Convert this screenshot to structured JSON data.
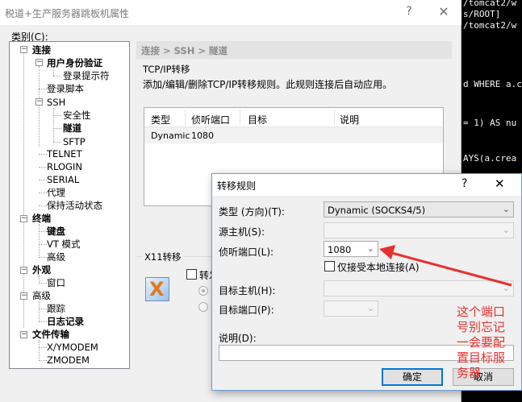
{
  "terminal": {
    "lines": [
      "/tomcat2/w",
      "s/ROOT]",
      "/tomcat2/w",
      "d WHERE a.c",
      "= 1) AS nu",
      "AYS(a.crea"
    ]
  },
  "main_dialog": {
    "title": "税道+生产服务器跳板机属性",
    "help": "?",
    "close": "✕",
    "category_label": "类别(C):",
    "tree": {
      "connect": "连接",
      "auth": "用户身份验证",
      "login_prompt": "登录提示符",
      "login_script": "登录脚本",
      "ssh": "SSH",
      "security": "安全性",
      "tunnel": "隧道",
      "sftp": "SFTP",
      "telnet": "TELNET",
      "rlogin": "RLOGIN",
      "serial": "SERIAL",
      "proxy": "代理",
      "keepalive": "保持活动状态",
      "terminal": "终端",
      "keyboard": "键盘",
      "vt_mode": "VT 模式",
      "term_advanced": "高级",
      "appearance": "外观",
      "window": "窗口",
      "advanced": "高级",
      "trace": "跟踪",
      "log": "日志记录",
      "file_transfer": "文件传输",
      "xymodem": "X/YMODEM",
      "zmodem": "ZMODEM"
    },
    "breadcrumb": "连接 > SSH > 隧道",
    "tcpip_label": "TCP/IP转移",
    "tcpip_desc": "添加/编辑/删除TCP/IP转移规则。此规则连接后自动应用。",
    "table": {
      "headers": [
        "类型",
        "侦听端口",
        "目标",
        "说明"
      ],
      "rows": [
        [
          "Dynamic",
          "1080",
          "",
          ""
        ]
      ]
    },
    "x11_label": "X11转移",
    "x11_check_label": "转发"
  },
  "fwd_dialog": {
    "title": "转移规则",
    "help": "?",
    "close": "✕",
    "type_label": "类型 (方向)(T):",
    "type_value": "Dynamic (SOCKS4/5)",
    "source_host_label": "源主机(S):",
    "listen_port_label": "侦听端口(L):",
    "listen_port_value": "1080",
    "local_only_label": "仅接受本地连接(A)",
    "dest_host_label": "目标主机(H):",
    "dest_port_label": "目标端口(P):",
    "desc_label": "说明(D):",
    "ok": "确定",
    "cancel": "取消"
  },
  "annotation": {
    "text": "这个端口号别忘记一会要配置目标服务器",
    "color": "#e8312f"
  }
}
